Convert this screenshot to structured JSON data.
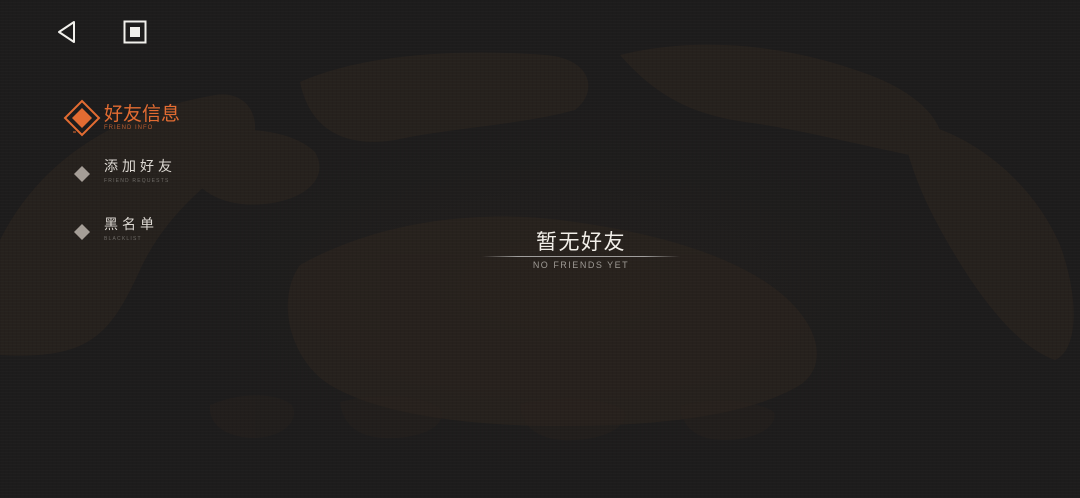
{
  "colors": {
    "background": "#1d1c1c",
    "accent": "#e36c32",
    "text_primary": "#f2efe9",
    "text_secondary": "#9e9a95",
    "inactive_icon": "#a59e97"
  },
  "navigation": {
    "back_icon": "back-triangle-icon",
    "stop_icon": "stop-square-icon"
  },
  "menu": {
    "items": [
      {
        "label": "好友信息",
        "sublabel": "FRIEND INFO",
        "icon": "active-diamond-icon",
        "active": true
      },
      {
        "label": "添加好友",
        "sublabel": "FRIEND REQUESTS",
        "icon": "diamond-icon",
        "active": false
      },
      {
        "label": "黑名单",
        "sublabel": "BLACKLIST",
        "icon": "diamond-icon",
        "active": false
      }
    ]
  },
  "empty_state": {
    "title": "暂无好友",
    "subtitle": "NO FRIENDS YET"
  }
}
